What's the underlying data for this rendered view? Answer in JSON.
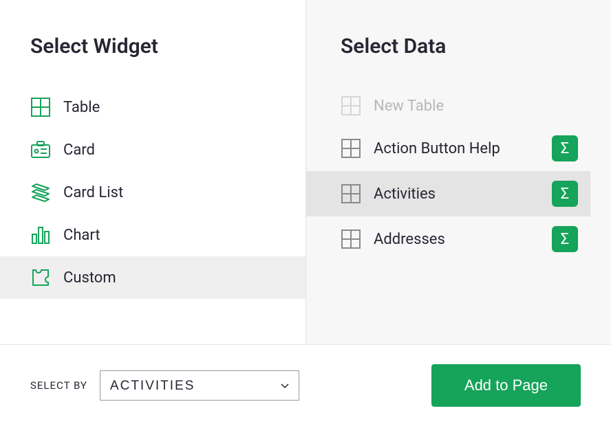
{
  "leftPanel": {
    "title": "Select Widget",
    "items": [
      {
        "key": "table",
        "label": "Table",
        "icon": "table-icon",
        "selected": false
      },
      {
        "key": "card",
        "label": "Card",
        "icon": "card-icon",
        "selected": false
      },
      {
        "key": "cardlist",
        "label": "Card List",
        "icon": "cardlist-icon",
        "selected": false
      },
      {
        "key": "chart",
        "label": "Chart",
        "icon": "chart-icon",
        "selected": false
      },
      {
        "key": "custom",
        "label": "Custom",
        "icon": "custom-icon",
        "selected": true
      }
    ]
  },
  "rightPanel": {
    "title": "Select Data",
    "items": [
      {
        "key": "newtable",
        "label": "New Table",
        "icon": "table-icon-gray",
        "selected": false,
        "disabled": true,
        "sigma": false
      },
      {
        "key": "actionbuttonhelp",
        "label": "Action Button Help",
        "icon": "table-icon-gray",
        "selected": false,
        "disabled": false,
        "sigma": true
      },
      {
        "key": "activities",
        "label": "Activities",
        "icon": "table-icon-gray",
        "selected": true,
        "disabled": false,
        "sigma": true
      },
      {
        "key": "addresses",
        "label": "Addresses",
        "icon": "table-icon-gray",
        "selected": false,
        "disabled": false,
        "sigma": true
      }
    ]
  },
  "footer": {
    "selectByLabel": "SELECT BY",
    "selectedOption": "ACTIVITIES",
    "addButton": "Add to Page"
  },
  "colors": {
    "accentGreen": "#16a35a",
    "iconGreen": "#16a35a",
    "iconGray": "#8a8a8a",
    "textDark": "#262633"
  }
}
